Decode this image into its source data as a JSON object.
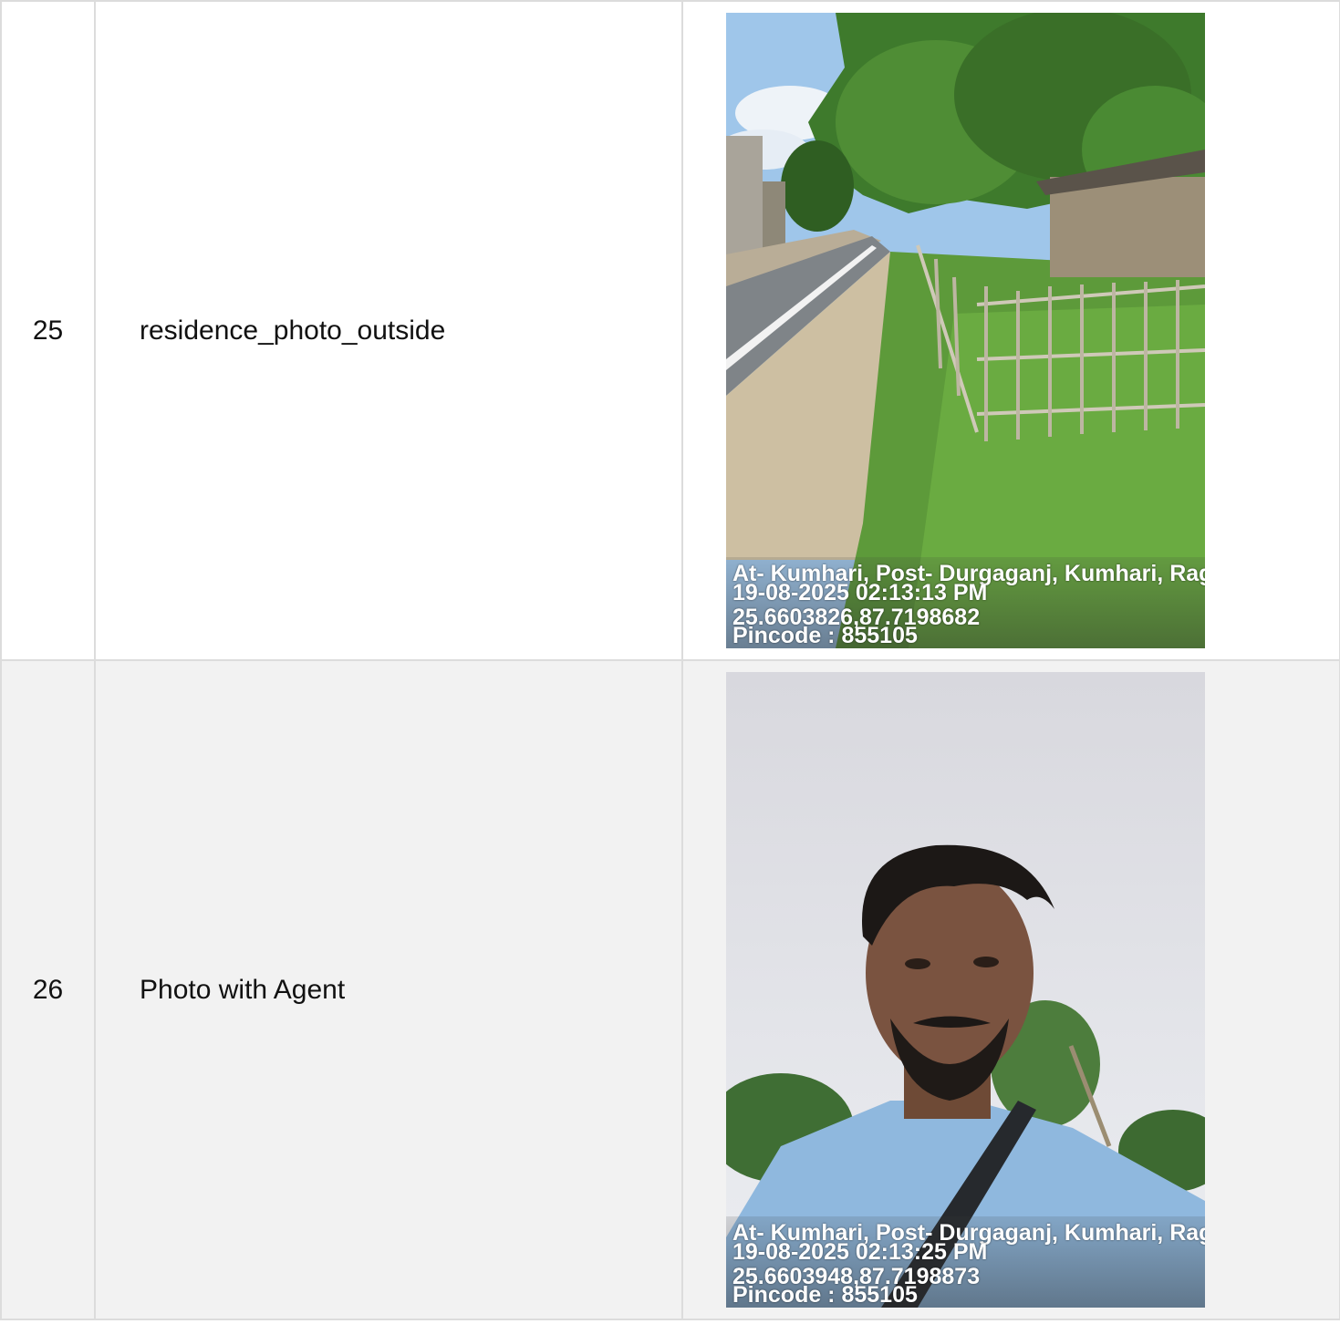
{
  "rows": [
    {
      "number": "25",
      "label": "residence_photo_outside",
      "photo": {
        "subject": "roadside residence with bamboo fence",
        "stamp_address": "At- Kumhari, Post- Durgaganj, Kumhari, Ragh",
        "stamp_datetime": "19-08-2025 02:13:13 PM",
        "stamp_coords": "25.6603826,87.7198682",
        "stamp_pincode": "Pincode : 855105"
      }
    },
    {
      "number": "26",
      "label": "Photo with Agent",
      "photo": {
        "subject": "selfie of agent outdoors",
        "stamp_address": "At- Kumhari, Post- Durgaganj, Kumhari, Ragh",
        "stamp_datetime": "19-08-2025 02:13:25 PM",
        "stamp_coords": "25.6603948,87.7198873",
        "stamp_pincode": "Pincode : 855105"
      }
    }
  ],
  "colors": {
    "border": "#dcdcdc",
    "row_alt_bg": "#f2f2f2",
    "row_bg": "#ffffff"
  }
}
